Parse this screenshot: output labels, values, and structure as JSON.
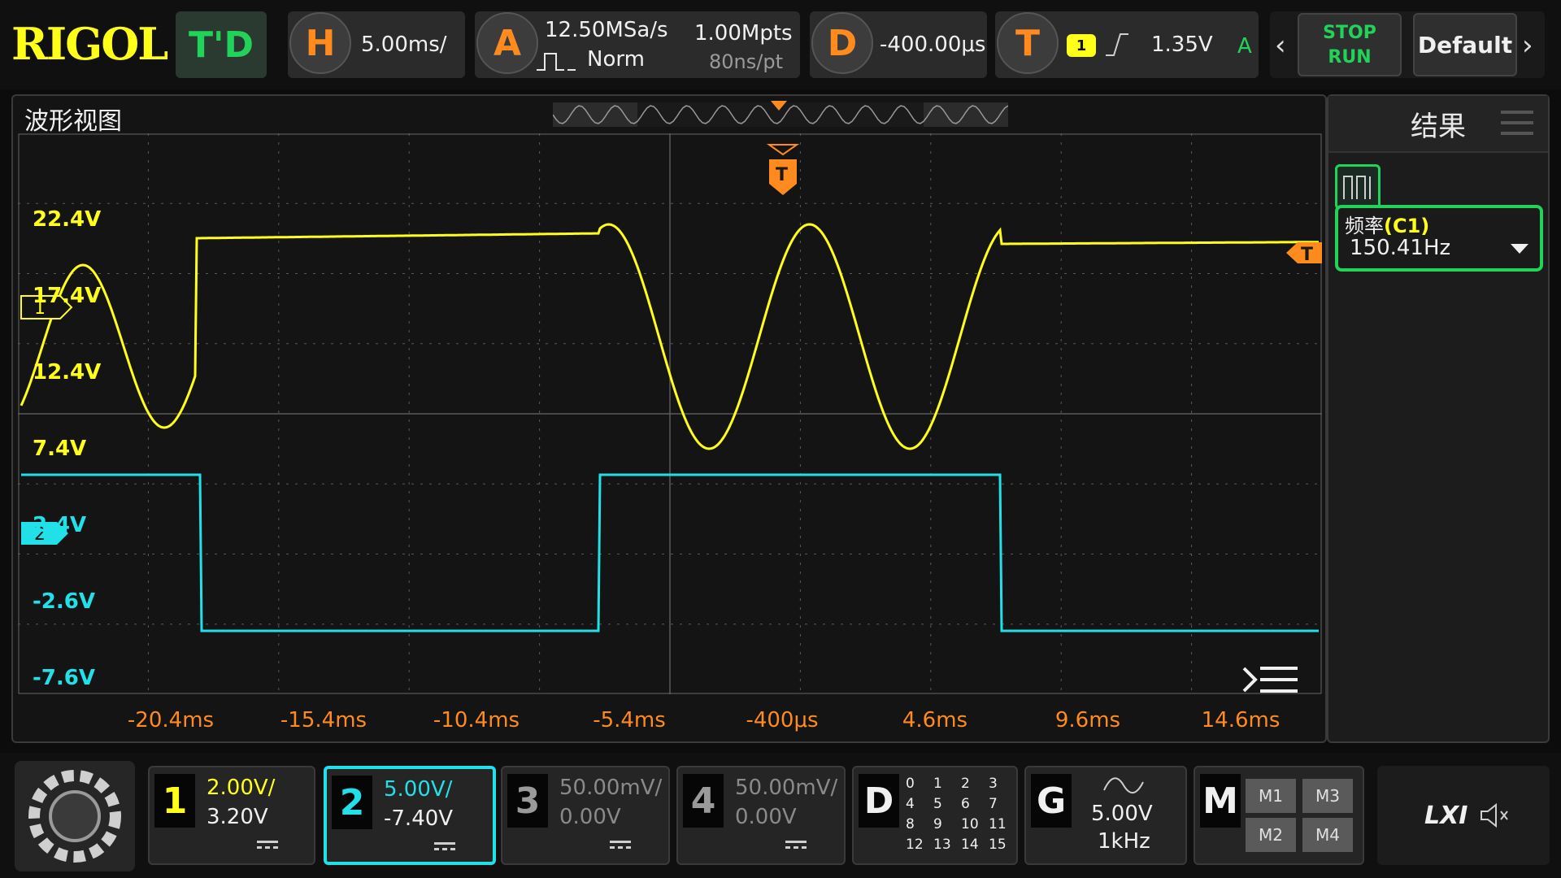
{
  "brand": "RIGOL",
  "header": {
    "mode_button": "T'D",
    "horizontal": {
      "badge": "H",
      "scale": "5.00ms/"
    },
    "acquire": {
      "badge": "A",
      "sample_rate": "12.50MSa/s",
      "depth": "1.00Mpts",
      "mode": "Norm",
      "resolution": "80ns/pt"
    },
    "delay": {
      "badge": "D",
      "value": "-400.00μs"
    },
    "trigger": {
      "badge": "T",
      "source": "1",
      "level": "1.35V",
      "sweep": "A"
    },
    "stop_label": "STOP",
    "run_label": "RUN",
    "default_label": "Default"
  },
  "waveform_view": {
    "title": "波形视图",
    "trigger_marker": "T",
    "level_marker": "T",
    "ch1_marker": "1",
    "ch2_marker": "2",
    "y_labels": [
      "22.4V",
      "17.4V",
      "12.4V",
      "7.4V",
      "2.4V",
      "-2.6V",
      "-7.6V"
    ],
    "x_labels": [
      "-20.4ms",
      "-15.4ms",
      "-10.4ms",
      "-5.4ms",
      "-400μs",
      "4.6ms",
      "9.6ms",
      "14.6ms"
    ]
  },
  "results": {
    "title": "结果",
    "measurement": {
      "name": "频率",
      "channel": "(C1)",
      "value": "150.41Hz"
    }
  },
  "channels": [
    {
      "num": "1",
      "scale": "2.00V/",
      "offset": "3.20V",
      "color": "#ffff1a",
      "active": false
    },
    {
      "num": "2",
      "scale": "5.00V/",
      "offset": "-7.40V",
      "color": "#22e0e8",
      "active": true
    },
    {
      "num": "3",
      "scale": "50.00mV/",
      "offset": "0.00V",
      "color": "#9a9a9a",
      "active": false
    },
    {
      "num": "4",
      "scale": "50.00mV/",
      "offset": "0.00V",
      "color": "#9a9a9a",
      "active": false
    }
  ],
  "digital": {
    "label": "D",
    "bits": [
      "0",
      "1",
      "2",
      "3",
      "4",
      "5",
      "6",
      "7",
      "8",
      "9",
      "10",
      "11",
      "12",
      "13",
      "14",
      "15"
    ]
  },
  "generator": {
    "label": "G",
    "amplitude": "5.00V",
    "frequency": "1kHz"
  },
  "math": {
    "label": "M",
    "buttons": [
      "M1",
      "M3",
      "M2",
      "M4"
    ]
  },
  "lxi_label": "LXI",
  "colors": {
    "ch1": "#ffff1a",
    "ch2": "#22e0e8",
    "trigger": "#ff8a1e",
    "accent": "#22d35a"
  },
  "icons": [
    "gear-logo-icon",
    "mute-icon",
    "menu-icon",
    "pulse-icon",
    "sine-icon",
    "trigger-edge-icon",
    "chevron-left-icon",
    "chevron-right-icon",
    "dropdown-caret-icon",
    "measure-icon"
  ]
}
